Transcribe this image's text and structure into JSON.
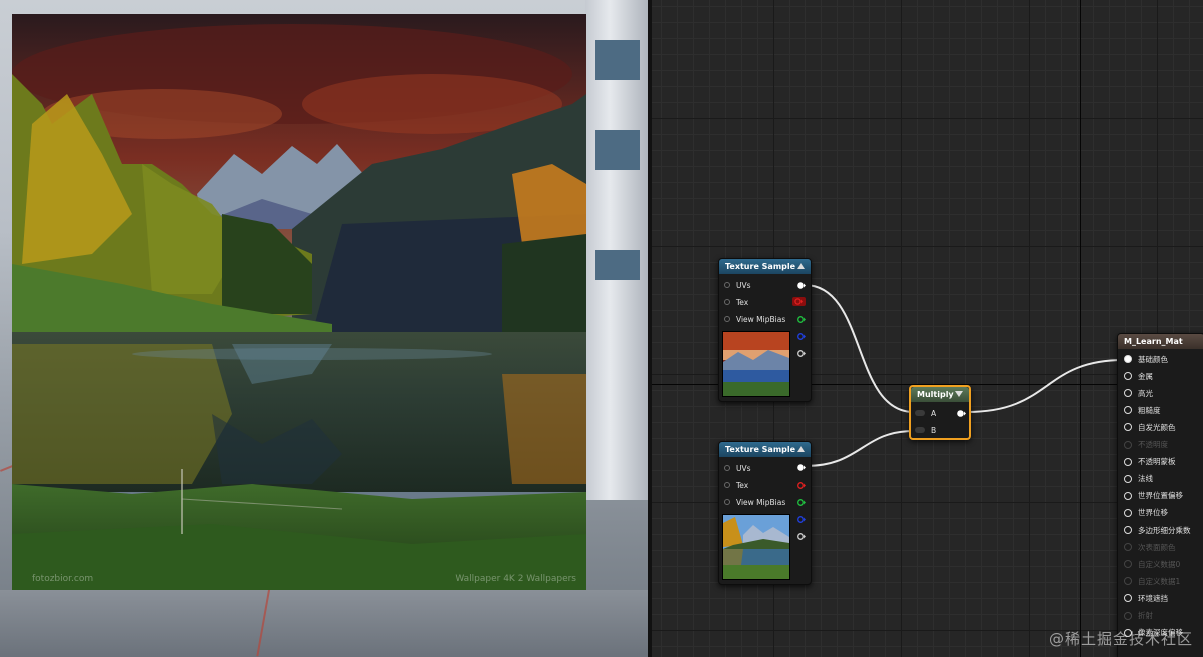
{
  "viewport": {
    "canvas_watermark_left": "fotozbior.com",
    "canvas_watermark_right": "Wallpaper 4K 2 Wallpapers"
  },
  "graph": {
    "texture_node_1": {
      "title": "Texture Sample",
      "pins": [
        "UVs",
        "Tex",
        "View MipBias"
      ],
      "thumbnail": "sunset-mountain-lake-thumbnail"
    },
    "texture_node_2": {
      "title": "Texture Sample",
      "pins": [
        "UVs",
        "Tex",
        "View MipBias"
      ],
      "thumbnail": "autumn-lake-thumbnail"
    },
    "multiply_node": {
      "title": "Multiply",
      "pins": [
        "A",
        "B"
      ]
    },
    "material_node": {
      "title": "M_Learn_Mat",
      "pins": [
        {
          "label": "基础颜色",
          "enabled": true,
          "connected": true
        },
        {
          "label": "金属",
          "enabled": true
        },
        {
          "label": "高光",
          "enabled": true
        },
        {
          "label": "粗糙度",
          "enabled": true
        },
        {
          "label": "自发光颜色",
          "enabled": true
        },
        {
          "label": "不透明度",
          "enabled": false
        },
        {
          "label": "不透明蒙板",
          "enabled": true
        },
        {
          "label": "法线",
          "enabled": true
        },
        {
          "label": "世界位置偏移",
          "enabled": true
        },
        {
          "label": "世界位移",
          "enabled": true
        },
        {
          "label": "多边形细分乘数",
          "enabled": true
        },
        {
          "label": "次表面颜色",
          "enabled": false
        },
        {
          "label": "自定义数据0",
          "enabled": false
        },
        {
          "label": "自定义数据1",
          "enabled": false
        },
        {
          "label": "环境遮挡",
          "enabled": true
        },
        {
          "label": "折射",
          "enabled": false
        },
        {
          "label": "像素深度偏移",
          "enabled": true
        }
      ]
    }
  },
  "watermark": "@稀土掘金技术社区",
  "colors": {
    "texture_header": "#2f6a8e",
    "multiply_header": "#5d7a5a",
    "material_header": "#5a4b43",
    "selected_border": "#f0a020",
    "pin_red": "#e02020",
    "pin_green": "#20c040",
    "pin_blue": "#2040e0"
  }
}
